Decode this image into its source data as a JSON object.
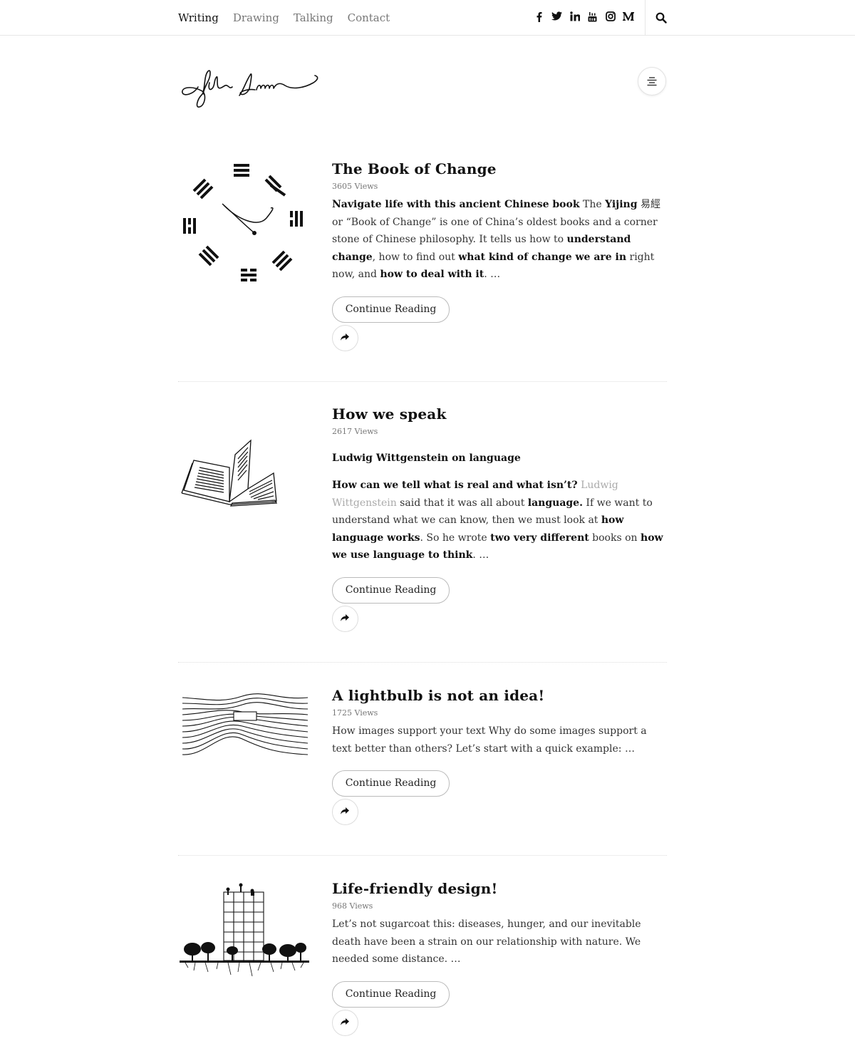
{
  "nav": {
    "items": [
      "Writing",
      "Drawing",
      "Talking",
      "Contact"
    ]
  },
  "social": [
    "facebook-icon",
    "twitter-icon",
    "linkedin-icon",
    "youtube-icon",
    "instagram-icon",
    "medium-icon"
  ],
  "posts": [
    {
      "title": "The Book of Change",
      "views": "3605 Views",
      "excerpt_parts": [
        {
          "t": "Navigate life with this ancient Chinese book",
          "b": true
        },
        {
          "t": " The ",
          "b": false
        },
        {
          "t": "Yijing",
          "b": true
        },
        {
          "t": " 易經 or “Book of Change” is one of China’s oldest books and a corner stone of Chinese philosophy. It tells us how to ",
          "b": false
        },
        {
          "t": "understand change",
          "b": true
        },
        {
          "t": ", how to find out ",
          "b": false
        },
        {
          "t": "what kind of change we are in",
          "b": true
        },
        {
          "t": " right now, and ",
          "b": false
        },
        {
          "t": "how to deal with it",
          "b": true
        },
        {
          "t": ". …",
          "b": false
        }
      ],
      "button": "Continue Reading"
    },
    {
      "title": "How we speak",
      "views": "2617 Views",
      "subtitle": "Ludwig Wittgenstein on language",
      "excerpt_parts": [
        {
          "t": "How can we tell what is real and what isn’t?",
          "b": true
        },
        {
          "t": " ",
          "b": false
        },
        {
          "t": "Ludwig Wittgenstein",
          "b": false,
          "muted": true
        },
        {
          "t": " said that it was all about ",
          "b": false
        },
        {
          "t": "language.",
          "b": true
        },
        {
          "t": " If we want to understand what we can know, then we must look at ",
          "b": false
        },
        {
          "t": "how language works",
          "b": true
        },
        {
          "t": ". So he wrote ",
          "b": false
        },
        {
          "t": "two very different",
          "b": true
        },
        {
          "t": " books on ",
          "b": false
        },
        {
          "t": "how we use language to think",
          "b": true
        },
        {
          "t": ". …",
          "b": false
        }
      ],
      "button": "Continue Reading"
    },
    {
      "title": "A lightbulb is not an idea!",
      "views": "1725 Views",
      "excerpt_parts": [
        {
          "t": "How images support your text Why do some images support a text better than others? Let’s start with a quick example: …",
          "b": false
        }
      ],
      "button": "Continue Reading"
    },
    {
      "title": "Life-friendly design!",
      "views": "968 Views",
      "excerpt_parts": [
        {
          "t": "Let’s not sugarcoat this: diseases, hunger, and our inevitable death have been a strain on our relationship with nature. We needed some distance. …",
          "b": false
        }
      ],
      "button": "Continue Reading"
    }
  ]
}
